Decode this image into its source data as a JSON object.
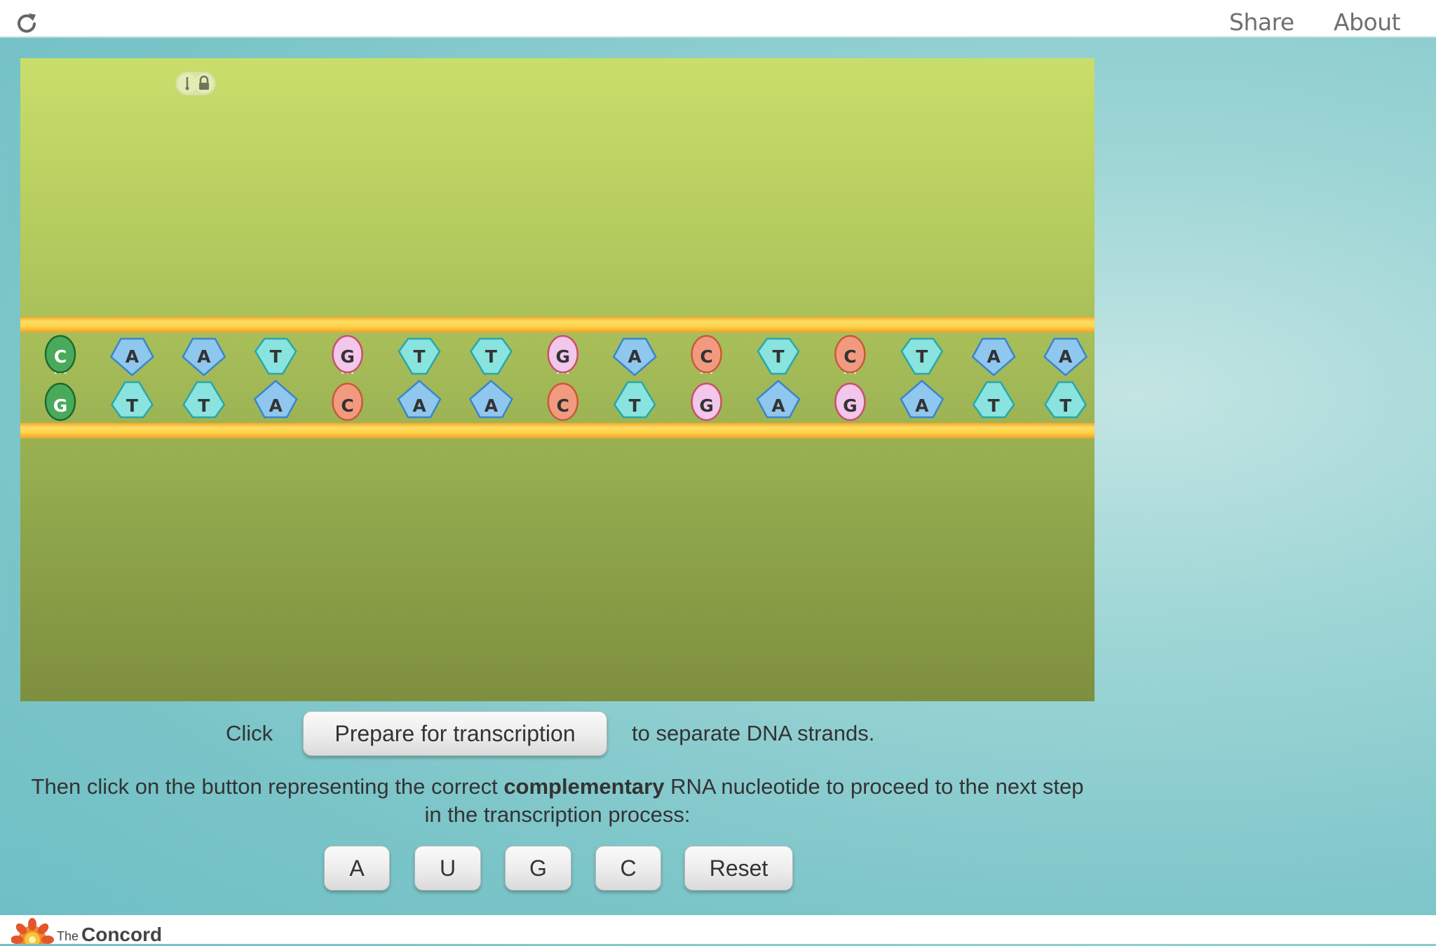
{
  "header": {
    "share_label": "Share",
    "about_label": "About"
  },
  "dna": {
    "top_strand": [
      "C",
      "A",
      "A",
      "T",
      "G",
      "T",
      "T",
      "G",
      "A",
      "C",
      "T",
      "C",
      "T",
      "A",
      "A"
    ],
    "bottom_strand": [
      "G",
      "T",
      "T",
      "A",
      "C",
      "A",
      "A",
      "C",
      "T",
      "G",
      "A",
      "G",
      "A",
      "T",
      "T"
    ]
  },
  "nucleotide_colors": {
    "A": "#8fc7ef",
    "T": "#89e3df",
    "G": "#f3c6ec",
    "C": "#f29a7f",
    "first_pair": "#4aaa5b"
  },
  "controls": {
    "click_label": "Click",
    "prepare_button_label": "Prepare for transcription",
    "separate_text": "to separate DNA strands.",
    "instruction_before": "Then click on the button representing the correct ",
    "instruction_bold": "complementary",
    "instruction_after": " RNA nucleotide to proceed to the next step in the transcription process:",
    "nucleotide_buttons": [
      "A",
      "U",
      "G",
      "C"
    ],
    "reset_label": "Reset"
  },
  "footer": {
    "the_label": "The",
    "concord_label": "Concord"
  }
}
